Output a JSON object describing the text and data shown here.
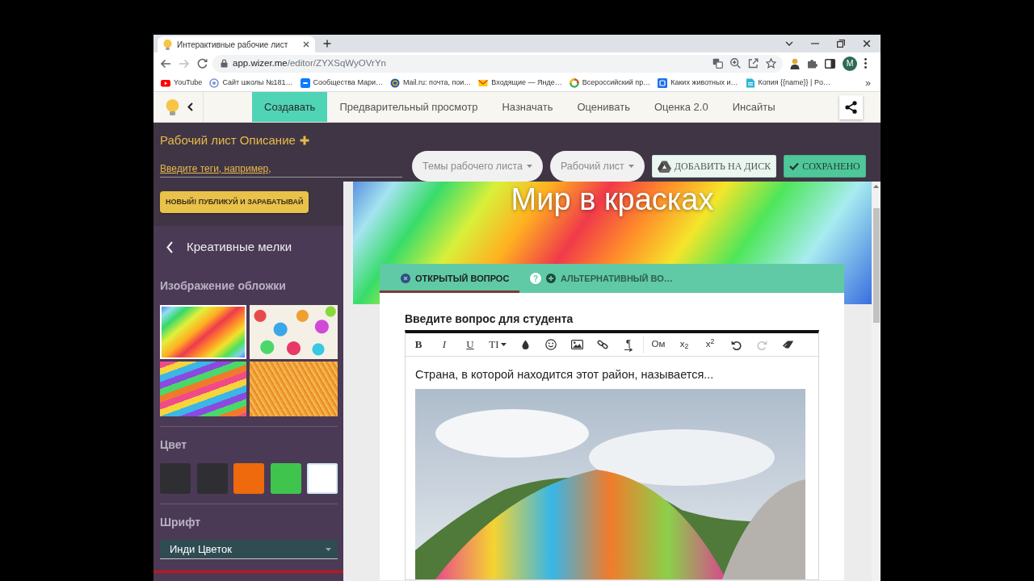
{
  "browser": {
    "tab_title": "Интерактивные рабочие лист",
    "url_host": "app.wizer.me",
    "url_path": "/editor/ZYXSqWyOVrYn",
    "profile_initial": "M",
    "bookmarks": [
      "YouTube",
      "Сайт школы №181…",
      "Сообщества Мари…",
      "Mail.ru: почта, пои…",
      "Входящие — Янде…",
      "Всероссийский пр…",
      "Каких животных и…",
      "Копия {{name}} | Po…"
    ],
    "bookmarks_more": "»"
  },
  "app_nav": {
    "tabs": [
      {
        "label": "Создавать",
        "selected": true
      },
      {
        "label": "Предварительный просмотр",
        "selected": false
      },
      {
        "label": "Назначать",
        "selected": false
      },
      {
        "label": "Оценивать",
        "selected": false
      },
      {
        "label": "Оценка 2.0",
        "selected": false
      },
      {
        "label": "Инсайты",
        "selected": false
      }
    ]
  },
  "header": {
    "title": "Рабочий лист Описание",
    "tags_field": {
      "placeholder": "Введите теги, например,"
    },
    "dropdowns": [
      "Темы рабочего листа",
      "Рабочий лист"
    ],
    "buttons": [
      {
        "kind": "drive",
        "label": "ДОБАВИТЬ НА ДИСК"
      },
      {
        "kind": "saved",
        "label": "СОХРАНЕНО"
      }
    ]
  },
  "sidebar": {
    "promo_button": "НОВЫЙ! ПУБЛИКУЙ И ЗАРАБАТЫВАЙ",
    "theme_title": "Креативные мелки",
    "cover_heading": "Изображение обложки",
    "covers": [
      {
        "selected": true
      },
      {
        "selected": false
      },
      {
        "selected": false
      },
      {
        "selected": false
      }
    ],
    "color_heading": "Цвет",
    "colors": [
      {
        "color": "#2f2f33",
        "selected": false
      },
      {
        "color": "#2f2f33",
        "selected": false
      },
      {
        "color": "#ee6a0c",
        "selected": false
      },
      {
        "color": "#3fc44e",
        "selected": false
      },
      {
        "color": "#ffffff",
        "selected": true
      }
    ],
    "font_heading": "Шрифт",
    "font_value": "Инди Цветок"
  },
  "worksheet": {
    "cover_title": "Мир в красках",
    "question_tabs": [
      {
        "label": "ОТКРЫТЫЙ ВОПРОС",
        "selected": true
      },
      {
        "label": "АЛЬТЕРНАТИВНЫЙ ВО…",
        "selected": false,
        "help": "?"
      }
    ],
    "prompt_label": "Введите вопрос для студента",
    "toolbar_groups": [
      {
        "tools": [
          {
            "kind": "bold",
            "label": "B",
            "disabled": false
          },
          {
            "kind": "italic",
            "label": "I",
            "disabled": false
          },
          {
            "kind": "underline",
            "label": "U",
            "disabled": false
          },
          {
            "kind": "size",
            "label": "TI",
            "disabled": false
          },
          {
            "kind": "color",
            "disabled": false
          },
          {
            "kind": "emoji",
            "disabled": false
          },
          {
            "kind": "image",
            "disabled": false
          },
          {
            "kind": "link",
            "disabled": false
          },
          {
            "kind": "paragraph",
            "label": "¶",
            "disabled": false
          }
        ]
      },
      {
        "tools": [
          {
            "kind": "symbol",
            "label": "Ом",
            "disabled": false
          },
          {
            "kind": "subscript",
            "label": "x$_{2}$",
            "disabled": false
          },
          {
            "kind": "superscript",
            "label": "x$^{2}$",
            "disabled": false
          },
          {
            "kind": "undo",
            "disabled": false
          },
          {
            "kind": "redo",
            "disabled": true
          },
          {
            "kind": "eraser",
            "disabled": false
          }
        ]
      }
    ],
    "question_text": "Страна, в которой находится этот район, называется..."
  }
}
